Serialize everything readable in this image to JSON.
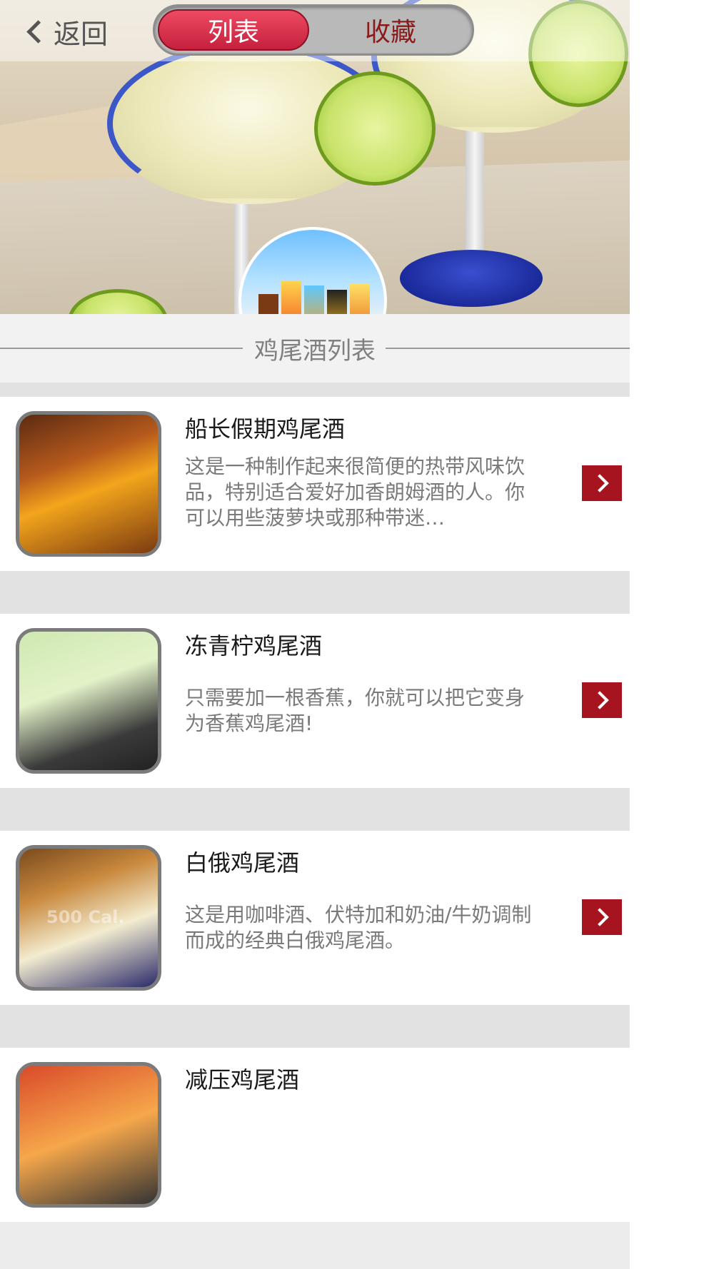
{
  "header": {
    "back_label": "返回",
    "tabs": [
      {
        "label": "列表",
        "active": true
      },
      {
        "label": "收藏",
        "active": false
      }
    ]
  },
  "section": {
    "title": "鸡尾酒列表"
  },
  "items": [
    {
      "title": "船长假期鸡尾酒",
      "desc": "这是一种制作起来很简便的热带风味饮品，特别适合爱好加香朗姆酒的人。你可以用些菠萝块或那种带迷…"
    },
    {
      "title": "冻青柠鸡尾酒",
      "desc": "只需要加一根香蕉，你就可以把它变身为香蕉鸡尾酒!"
    },
    {
      "title": "白俄鸡尾酒",
      "desc": "这是用咖啡酒、伏特加和奶油/牛奶调制而成的经典白俄鸡尾酒。"
    },
    {
      "title": "减压鸡尾酒",
      "desc": ""
    }
  ],
  "thumb_watermark": "500 Cal.",
  "colors": {
    "accent": "#a5141f",
    "tab_active": "#d9304a",
    "tab_inactive_text": "#8b1a1a"
  }
}
